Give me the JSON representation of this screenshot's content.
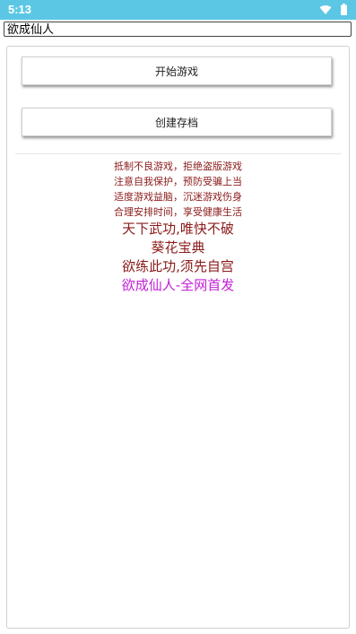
{
  "status_bar": {
    "time": "5:13",
    "icons": [
      "wifi-icon",
      "battery-icon"
    ],
    "background": "#5bc7e4"
  },
  "title_bar": {
    "title": "欲成仙人"
  },
  "buttons": {
    "start_game": "开始游戏",
    "create_save": "创建存档"
  },
  "health_notice": [
    "抵制不良游戏，拒绝盗版游戏",
    "注意自我保护，预防受骗上当",
    "适度游戏益脑，沉迷游戏伤身",
    "合理安排时间，享受健康生活"
  ],
  "slogans": [
    "天下武功,唯快不破",
    "葵花宝典",
    "欲练此功,须先自宫"
  ],
  "promo": "欲成仙人-全网首发",
  "colors": {
    "notice_text": "#8b1a1a",
    "promo_text": "#c21fd6"
  }
}
